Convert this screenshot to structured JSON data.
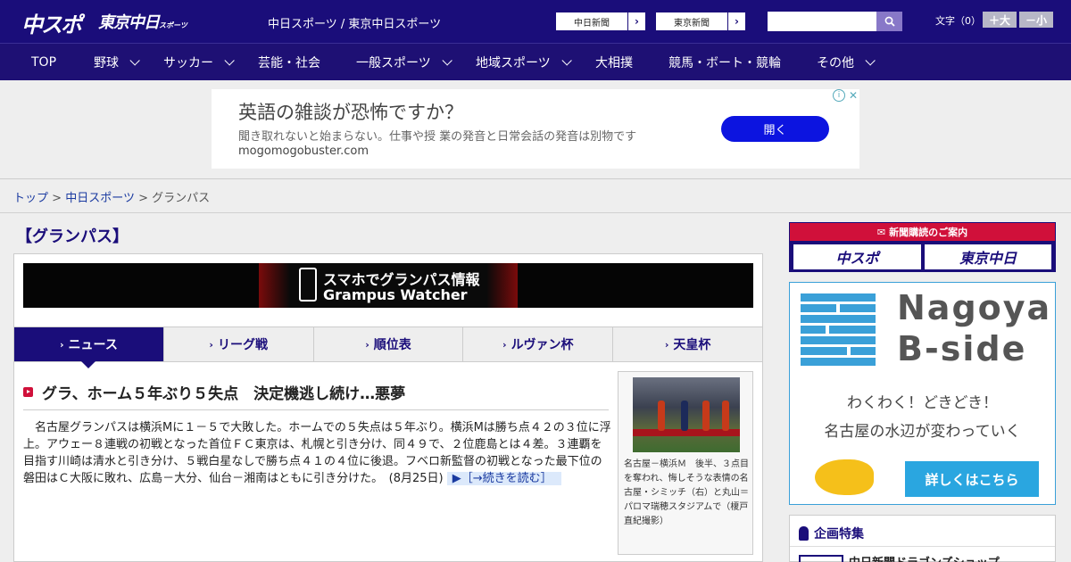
{
  "header": {
    "logo_main": "中スポ",
    "logo_tokyo": "東京中日",
    "logo_tokyo_small": "スポーツ",
    "site_title": "中日スポーツ / 東京中日スポーツ",
    "paper_links": [
      "中日新聞",
      "東京新聞"
    ],
    "search_placeholder": "",
    "font_size_label": "文字（0）",
    "font_larger": "＋大",
    "font_smaller": "－小"
  },
  "nav": {
    "items": [
      {
        "label": "TOP",
        "dropdown": false
      },
      {
        "label": "野球",
        "dropdown": true
      },
      {
        "label": "サッカー",
        "dropdown": true
      },
      {
        "label": "芸能・社会",
        "dropdown": false
      },
      {
        "label": "一般スポーツ",
        "dropdown": true
      },
      {
        "label": "地域スポーツ",
        "dropdown": true
      },
      {
        "label": "大相撲",
        "dropdown": false
      },
      {
        "label": "競馬・ボート・競輪",
        "dropdown": false
      },
      {
        "label": "その他",
        "dropdown": true
      }
    ]
  },
  "ad": {
    "title": "英語の雑談が恐怖ですか？",
    "description": "聞き取れないと始まらない。仕事や授 業の発音と日常会話の発音は別物です",
    "url": "mogomogobuster.com",
    "button": "開く"
  },
  "breadcrumb": {
    "items": [
      "トップ",
      "中日スポーツ"
    ],
    "current": "グランパス",
    "separator": ">"
  },
  "page": {
    "heading": "【グランパス】"
  },
  "watcher_banner": {
    "line1": "スマホでグランパス情報",
    "line2": "Grampus Watcher"
  },
  "tabs": [
    {
      "label": "ニュース",
      "active": true
    },
    {
      "label": "リーグ戦",
      "active": false
    },
    {
      "label": "順位表",
      "active": false
    },
    {
      "label": "ルヴァン杯",
      "active": false
    },
    {
      "label": "天皇杯",
      "active": false
    }
  ],
  "article": {
    "headline": "グラ、ホーム５年ぶり５失点　決定機逃し続け…悪夢",
    "body": "名古屋グランパスは横浜Mに１－５で大敗した。ホームでの５失点は５年ぶり。横浜Mは勝ち点４２の３位に浮上。アウェー８連戦の初戦となった首位ＦＣ東京は、札幌と引き分け、同４９で、２位鹿島とは４差。３連覇を目指す川崎は清水と引き分け、５戦白星なしで勝ち点４１の４位に後退。フベロ新監督の初戦となった最下位の磐田はＣ大阪に敗れ、広島－大分、仙台－湘南はともに引き分けた。　(8月25日)",
    "read_more": "▶［→続きを読む］",
    "photo_caption": "名古屋－横浜Ｍ　後半、３点目を奪われ、悔しそうな表情の名古屋・シミッチ（右）と丸山＝パロマ瑞穂スタジアムで（榎戸直紀撮影）"
  },
  "sidebar": {
    "subscribe_head": "新聞購読のご案内",
    "subscribe_logos": [
      "中スポ",
      "東京中日"
    ],
    "bside_title1": "Nagoya",
    "bside_title2": "B-side",
    "bside_copy1": "わくわく！どきどき！",
    "bside_copy2": "名古屋の水辺が変わっていく",
    "bside_button": "詳しくはこちら",
    "feature_head": "企画特集",
    "feature_item": "中日新聞ドラゴンズショップ"
  },
  "colors": {
    "brand_navy": "#1a0d7a",
    "accent_red": "#d0103a",
    "ad_button": "#0c14e0",
    "bside_blue": "#2aa6e0"
  }
}
